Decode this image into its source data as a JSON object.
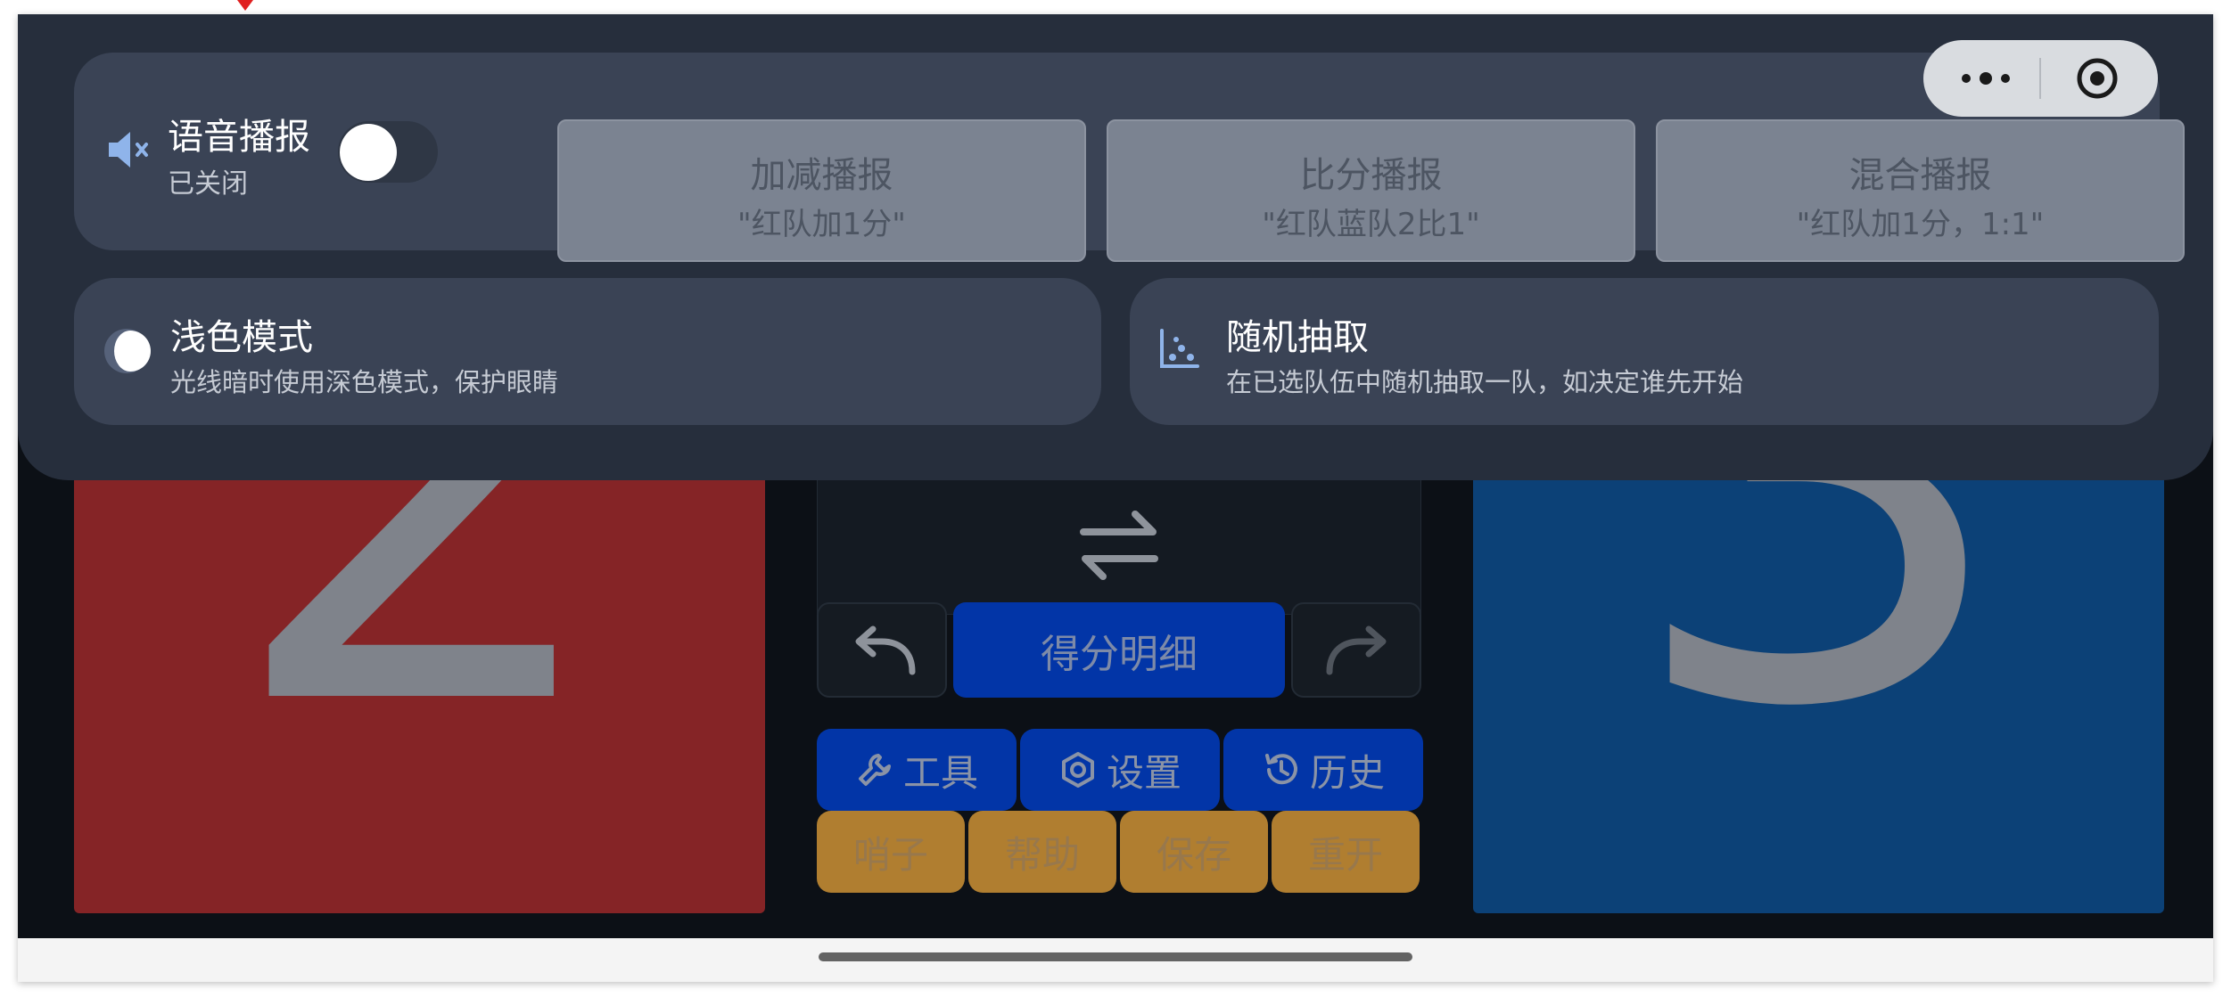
{
  "scoreboard": {
    "red_score": "2",
    "blue_score": "3",
    "detail_label": "得分明细",
    "tools_label": "工具",
    "settings_label": "设置",
    "history_label": "历史",
    "whistle_label": "哨子",
    "help_label": "帮助",
    "save_label": "保存",
    "restart_label": "重开"
  },
  "voice": {
    "title": "语音播报",
    "status": "已关闭",
    "enabled": false,
    "modes": [
      {
        "title": "加减播报",
        "example": "\"红队加1分\""
      },
      {
        "title": "比分播报",
        "example": "\"红队蓝队2比1\""
      },
      {
        "title": "混合播报",
        "example": "\"红队加1分，1:1\""
      }
    ]
  },
  "light_mode": {
    "title": "浅色模式",
    "subtitle": "光线暗时使用深色模式，保护眼睛"
  },
  "random_pick": {
    "title": "随机抽取",
    "subtitle": "在已选队伍中随机抽取一队，如决定谁先开始"
  },
  "colors": {
    "red_team": "#852426",
    "blue_team": "#0c4177",
    "primary_button": "#0235a7",
    "secondary_button": "#b07e30",
    "panel": "#262e3c"
  }
}
